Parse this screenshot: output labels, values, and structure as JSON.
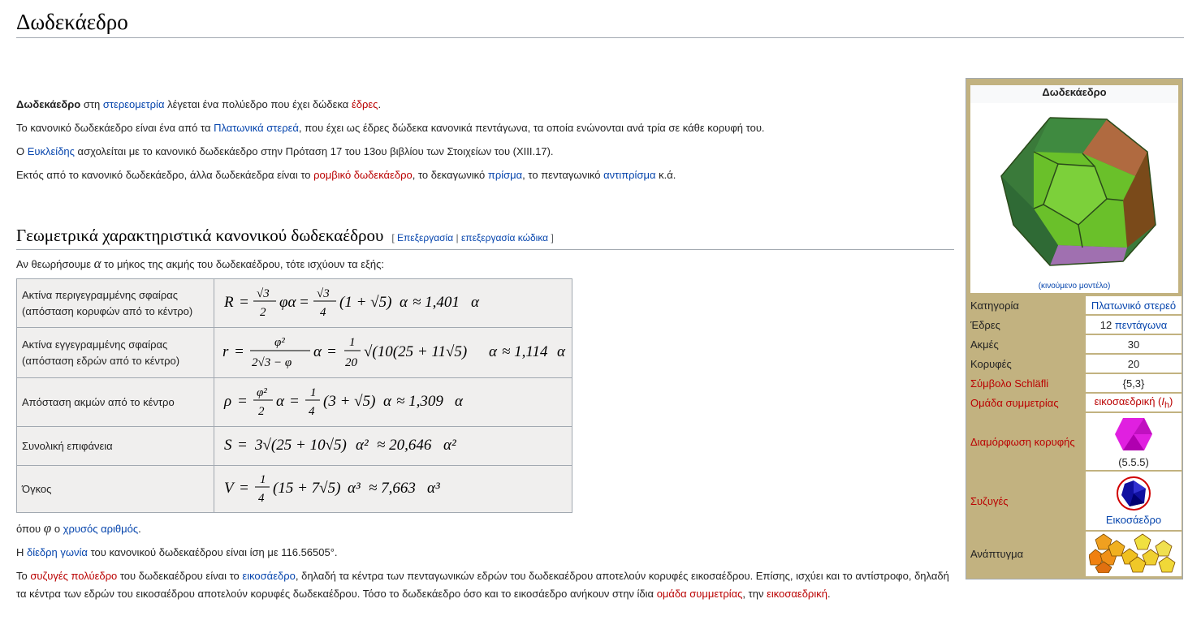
{
  "title": "Δωδεκάεδρο",
  "intro": {
    "p1": {
      "bold": "Δωδεκάεδρο",
      "t1": " στη ",
      "l1": "στερεομετρία",
      "t2": " λέγεται ένα πολύεδρο που έχει δώδεκα ",
      "l2": "έδρες",
      "t3": "."
    },
    "p2": {
      "t1": "Το κανονικό δωδεκάεδρο είναι ένα από τα ",
      "l1": "Πλατωνικά στερεά",
      "t2": ", που έχει ως έδρες δώδεκα κανονικά πεντάγωνα, τα οποία ενώνονται ανά τρία σε κάθε κορυφή του."
    },
    "p3": {
      "t1": "Ο ",
      "l1": "Ευκλείδης",
      "t2": " ασχολείται με το κανονικό δωδεκάεδρο στην Πρόταση 17 του 13ου βιβλίου των Στοιχείων του (XIII.17)."
    },
    "p4": {
      "t1": "Εκτός από το κανονικό δωδεκάεδρο, άλλα δωδεκάεδρα είναι το ",
      "l1": "ρομβικό δωδεκάεδρο",
      "t2": ", το δεκαγωνικό ",
      "l2": "πρίσμα",
      "t3": ", το πενταγωνικό ",
      "l3": "αντιπρίσμα",
      "t4": " κ.ά."
    }
  },
  "section": {
    "heading": "Γεωμετρικά χαρακτηριστικά κανονικού δωδεκαέδρου",
    "edit_open": "[ ",
    "edit": "Επεξεργασία",
    "edit_sep": " | ",
    "edit_code": "επεξεργασία κώδικα",
    "edit_close": " ]",
    "lead_t1": "Αν θεωρήσουμε ",
    "lead_sym": "α",
    "lead_t2": " το μήκος της ακμής του δωδεκαέδρου, τότε ισχύουν τα εξής:"
  },
  "rows": [
    {
      "label": "Ακτίνα περιγεγραμμένης σφαίρας (απόσταση κορυφών από το κέντρο)"
    },
    {
      "label": "Ακτίνα εγγεγραμμένης σφαίρας (απόσταση εδρών από το κέντρο)"
    },
    {
      "label": "Απόσταση ακμών από το κέντρο"
    },
    {
      "label": "Συνολική επιφάνεια"
    },
    {
      "label": "Όγκος"
    }
  ],
  "after": {
    "p1": {
      "t1": "όπου ",
      "sym": "φ",
      "t2": " ο ",
      "l1": "χρυσός αριθμός",
      "t3": "."
    },
    "p2": {
      "t1": "Η ",
      "l1": "δίεδρη γωνία",
      "t2": " του κανονικού δωδεκαέδρου είναι ίση με 116.56505°."
    },
    "p3": {
      "t1": "Το ",
      "l1": "συζυγές πολύεδρο",
      "t2": " του δωδεκαέδρου είναι το ",
      "l2": "εικοσάεδρο",
      "t3": ", δηλαδή τα κέντρα των πενταγωνικών εδρών του δωδεκαέδρου αποτελούν κορυφές εικοσαέδρου. Επίσης, ισχύει και το αντίστροφο, δηλαδή τα κέντρα των εδρών του εικοσαέδρου αποτελούν κορυφές δωδεκαέδρου. Τόσο το δωδεκάεδρο όσο και το εικοσάεδρο ανήκουν στην ίδια ",
      "l3": "ομάδα συμμετρίας",
      "t4": ", την ",
      "l4": "εικοσαεδρική",
      "t5": "."
    }
  },
  "infobox": {
    "title": "Δωδεκάεδρο",
    "caption": "(κινούμενο μοντέλο)",
    "rows": [
      {
        "key": "Κατηγορία",
        "value": "Πλατωνικό στερεό"
      },
      {
        "key": "Έδρες",
        "value_pre": "12 ",
        "value": "πεντάγωνα"
      },
      {
        "key": "Ακμές",
        "value": "30"
      },
      {
        "key": "Κορυφές",
        "value": "20"
      },
      {
        "key": "Σύμβολο Schläfli",
        "value": "{5,3}"
      },
      {
        "key": "Ομάδα συμμετρίας",
        "value": "εικοσαεδρική (",
        "value_i": "I",
        "value_sub": "h",
        "value_post": ")"
      },
      {
        "key": "Διαμόρφωση κορυφής",
        "value": "(5.5.5)"
      },
      {
        "key": "Συζυγές",
        "value": "Εικοσάεδρο"
      },
      {
        "key": "Ανάπτυγμα"
      }
    ]
  }
}
